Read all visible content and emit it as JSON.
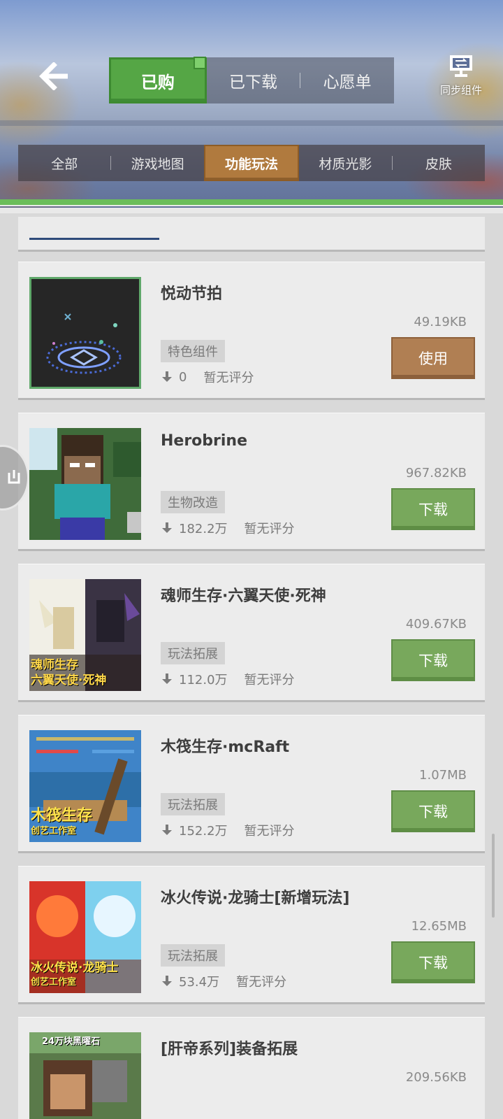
{
  "header": {
    "back_icon": "arrow-left-icon",
    "top_tabs": [
      {
        "label": "已购",
        "active": true
      },
      {
        "label": "已下载",
        "active": false
      },
      {
        "label": "心愿单",
        "active": false
      }
    ],
    "sync_label": "同步组件",
    "sync_icon": "sync-components-icon",
    "categories": [
      {
        "label": "全部",
        "active": false
      },
      {
        "label": "游戏地图",
        "active": false
      },
      {
        "label": "功能玩法",
        "active": true
      },
      {
        "label": "材质光影",
        "active": false
      },
      {
        "label": "皮肤",
        "active": false
      }
    ]
  },
  "items": [
    {
      "title": "悦动节拍",
      "size": "49.19KB",
      "tag": "特色组件",
      "downloads": "0",
      "rating": "暂无评分",
      "action": "使用",
      "action_style": "brown"
    },
    {
      "title": "Herobrine",
      "size": "967.82KB",
      "tag": "生物改造",
      "downloads": "182.2万",
      "rating": "暂无评分",
      "action": "下载",
      "action_style": "green"
    },
    {
      "title": "魂师生存·六翼天使·死神",
      "size": "409.67KB",
      "tag": "玩法拓展",
      "downloads": "112.0万",
      "rating": "暂无评分",
      "action": "下载",
      "action_style": "green",
      "thumb_text": [
        "魂师生存",
        "六翼天使·死神"
      ]
    },
    {
      "title": "木筏生存·mcRaft",
      "size": "1.07MB",
      "tag": "玩法拓展",
      "downloads": "152.2万",
      "rating": "暂无评分",
      "action": "下载",
      "action_style": "green",
      "thumb_text": [
        "木筏生存",
        "创艺工作室"
      ]
    },
    {
      "title": "冰火传说·龙骑士[新增玩法]",
      "size": "12.65MB",
      "tag": "玩法拓展",
      "downloads": "53.4万",
      "rating": "暂无评分",
      "action": "下载",
      "action_style": "green",
      "thumb_text": [
        "冰火传说·龙骑士",
        "创艺工作室"
      ]
    },
    {
      "title": "[肝帝系列]装备拓展",
      "size": "209.56KB",
      "tag": "",
      "downloads": "",
      "rating": "",
      "action": "",
      "action_style": "green",
      "thumb_text": [
        "24万块黑曜石"
      ]
    }
  ],
  "colors": {
    "active_top_tab": "#55a645",
    "active_category": "#b07a3e",
    "download_button": "#78a85c",
    "use_button": "#b07f53"
  }
}
